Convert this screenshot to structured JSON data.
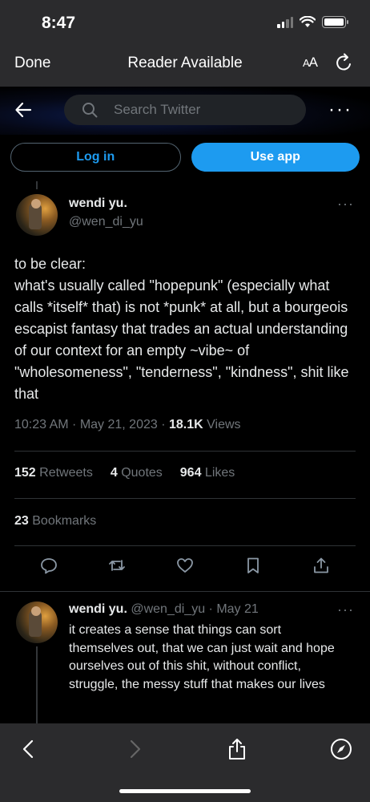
{
  "status": {
    "time": "8:47"
  },
  "safari": {
    "done": "Done",
    "reader": "Reader Available",
    "aa_big": "A",
    "aa_small": "A"
  },
  "header": {
    "search_placeholder": "Search Twitter"
  },
  "buttons": {
    "login": "Log in",
    "use_app": "Use app"
  },
  "tweet": {
    "name": "wendi yu.",
    "handle": "@wen_di_yu",
    "text": "to be clear:\nwhat's usually called \"hopepunk\" (especially what calls *itself* that) is not *punk* at all, but a bourgeois escapist fantasy that trades an actual understanding of our context for an empty ~vibe~ of \"wholesomeness\", \"tenderness\", \"kindness\", shit like that",
    "timestamp": "10:23 AM · May 21, 2023 · ",
    "views_count": "18.1K",
    "views_label": " Views",
    "retweets_count": "152",
    "retweets_label": " Retweets",
    "quotes_count": "4",
    "quotes_label": " Quotes",
    "likes_count": "964",
    "likes_label": " Likes",
    "bookmarks_count": "23",
    "bookmarks_label": " Bookmarks"
  },
  "reply": {
    "name": "wendi yu.",
    "handle": "@wen_di_yu",
    "date": " · May 21",
    "text": "it creates a sense that things can sort themselves out, that we can just wait and hope ourselves out of this shit, without conflict, struggle, the messy stuff that makes our lives"
  },
  "colors": {
    "accent": "#1d9bf0",
    "background": "#000000",
    "muted": "#71767b",
    "chrome": "#2b2b2d"
  },
  "icons": [
    "back-arrow-icon",
    "search-icon",
    "more-icon",
    "reply-icon",
    "retweet-icon",
    "like-icon",
    "bookmark-icon",
    "share-icon",
    "safari-back-icon",
    "safari-forward-icon",
    "safari-share-icon",
    "compass-icon",
    "reload-icon"
  ]
}
